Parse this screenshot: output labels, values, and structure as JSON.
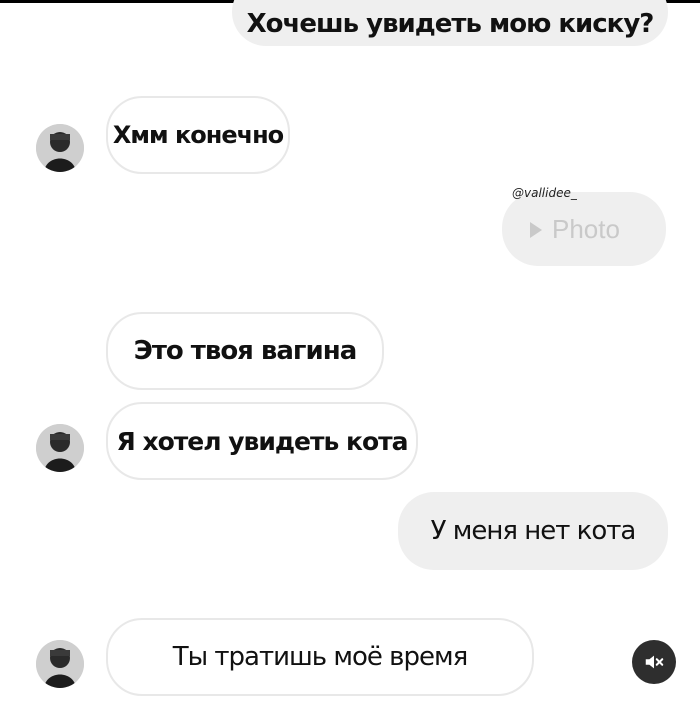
{
  "messages": {
    "m1": "Хочешь увидеть мою киску?",
    "m2": "Хмм конечно",
    "m3": "Это твоя вагина",
    "m4": "Я хотел увидеть кота",
    "m5": "У меня нет кота",
    "m6": "Ты тратишь моё время"
  },
  "photo": {
    "handle": "@vallidee_",
    "label": "Photo",
    "icon": "play-icon"
  },
  "controls": {
    "mute_icon": "mute-icon"
  },
  "colors": {
    "outgoing_bubble": "#efefef",
    "incoming_border": "#e8e8e8",
    "photo_text": "#c9c9c9",
    "mute_button": "#2e2e2e"
  }
}
